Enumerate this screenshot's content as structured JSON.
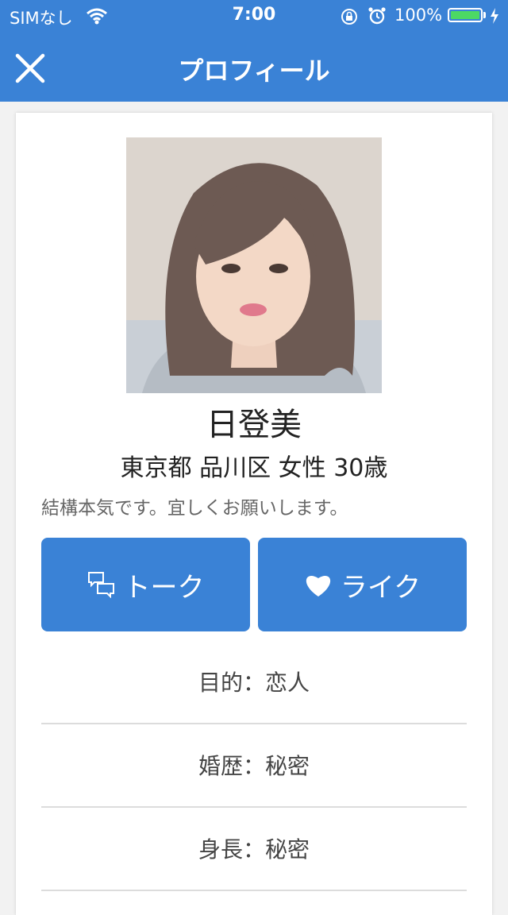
{
  "status_bar": {
    "carrier": "SIMなし",
    "time": "7:00",
    "battery": "100%",
    "battery_level": 1.0
  },
  "nav": {
    "title": "プロフィール",
    "close_icon": "close-icon"
  },
  "profile": {
    "name": "日登美",
    "meta": "東京都 品川区 女性 30歳",
    "intro": "結構本気です。宜しくお願いします。"
  },
  "actions": {
    "talk_label": "トーク",
    "talk_icon": "chat-bubbles-icon",
    "like_label": "ライク",
    "like_icon": "heart-icon"
  },
  "details": [
    "目的：恋人",
    "婚歴：秘密",
    "身長：秘密"
  ],
  "colors": {
    "accent": "#3a82d6",
    "battery_fill": "#4cd964"
  }
}
